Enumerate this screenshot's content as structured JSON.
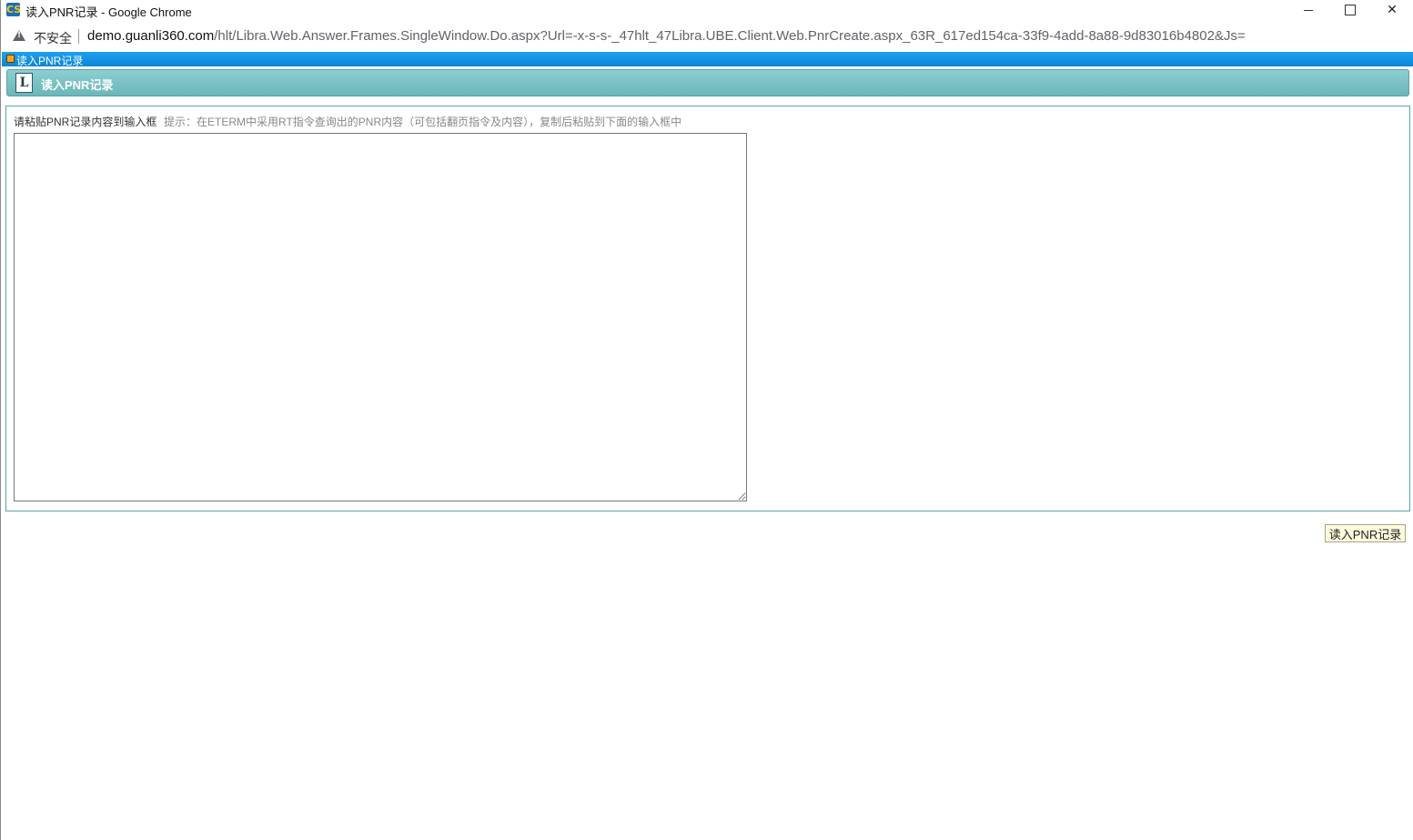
{
  "window": {
    "title": "读入PNR记录 - Google Chrome",
    "app_icon": "CS"
  },
  "address_bar": {
    "security_label": "不安全",
    "url_host": "demo.guanli360.com",
    "url_path": "/hlt/Libra.Web.Answer.Frames.SingleWindow.Do.aspx?Url=-x-s-s-_47hlt_47Libra.UBE.Client.Web.PnrCreate.aspx_63R_617ed154ca-33f9-4add-8a88-9d83016b4802&Js="
  },
  "window_strip": {
    "title": "读入PNR记录"
  },
  "panel": {
    "icon_letter": "L",
    "title": "读入PNR记录"
  },
  "form": {
    "label": "请粘贴PNR记录内容到输入框",
    "hint": "提示：在ETERM中采用RT指令查询出的PNR内容（可包括翻页指令及内容），复制后粘贴到下面的输入框中",
    "input_value": ""
  },
  "actions": {
    "submit_label": "读入PNR记录"
  },
  "colors": {
    "strip_blue": "#0b86d6",
    "panel_teal": "#6bb5b8",
    "button_bg": "#fdfbdc"
  }
}
